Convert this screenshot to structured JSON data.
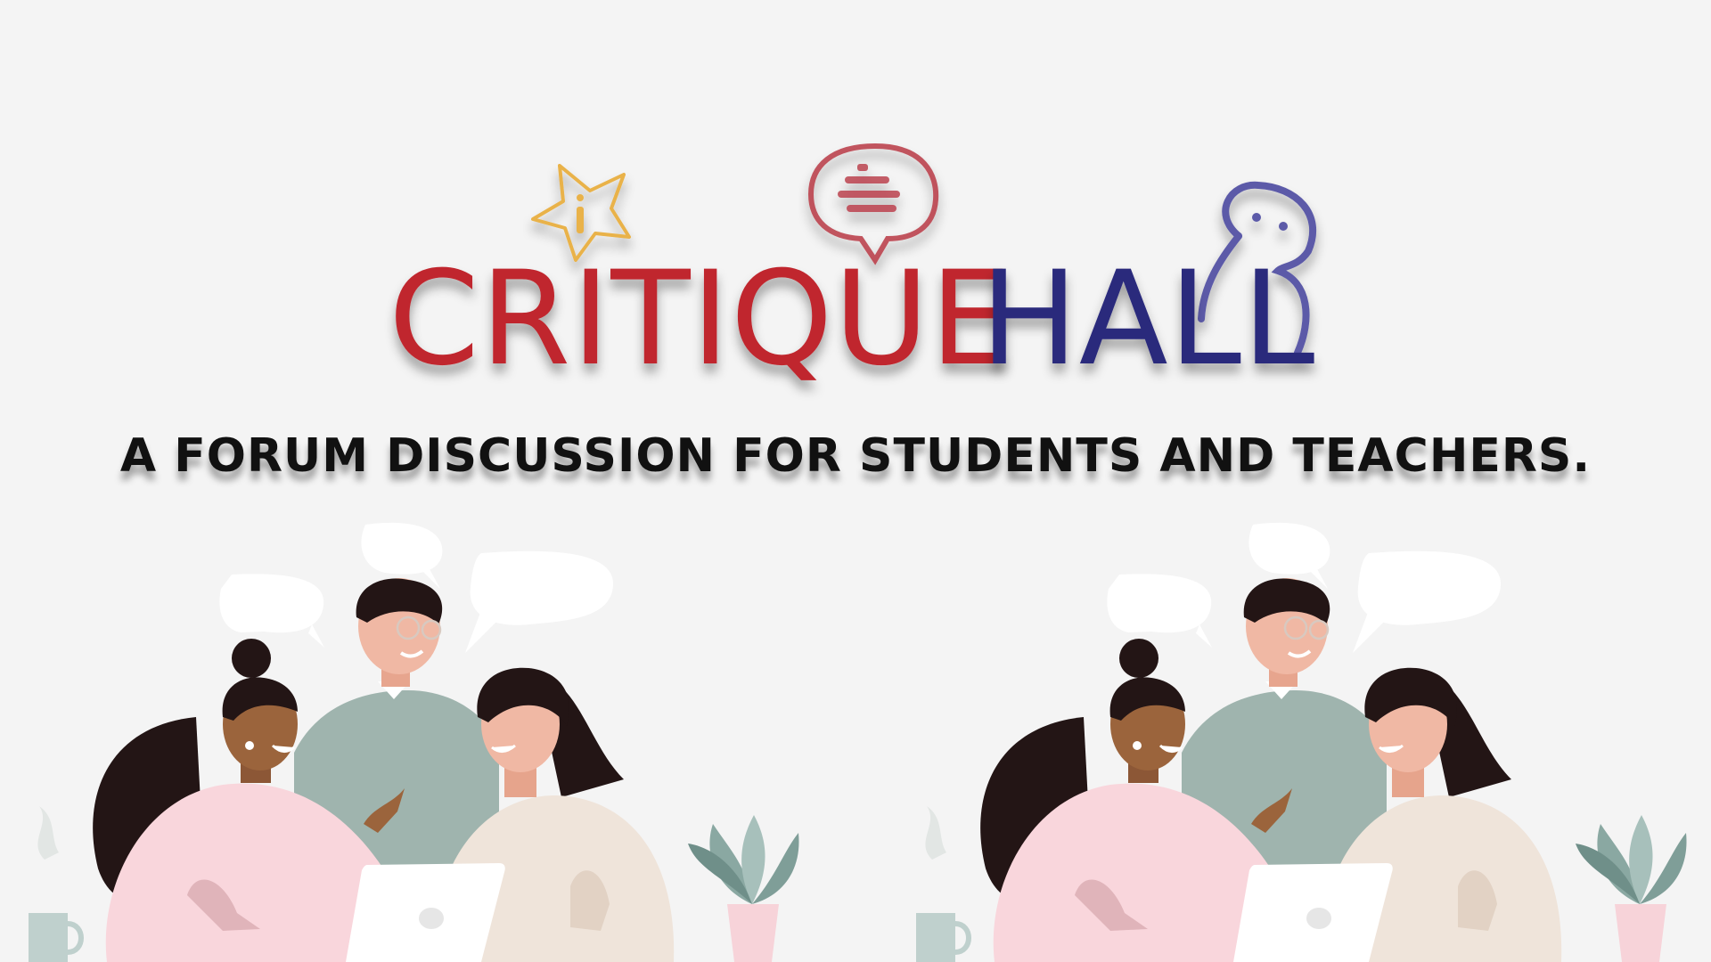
{
  "logo": {
    "word1": "CRITIQUE",
    "word2": "HALL",
    "word1_color": "#c0272d",
    "word2_color": "#2b2a7c",
    "icons": [
      "star-info-icon",
      "chat-bubble-icon",
      "person-icon"
    ]
  },
  "tagline": "A FORUM DISCUSSION FOR STUDENTS AND TEACHERS.",
  "illustrations": [
    "group-discussion-illustration",
    "group-discussion-illustration"
  ]
}
